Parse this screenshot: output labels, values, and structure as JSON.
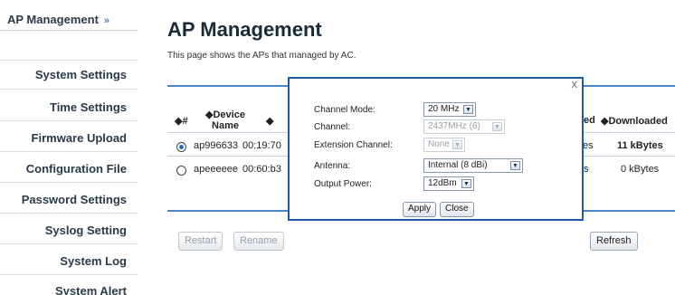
{
  "sidebar": {
    "header": "AP Management",
    "items": [
      {
        "label": "System Settings"
      },
      {
        "label": "Time Settings"
      },
      {
        "label": "Firmware Upload"
      },
      {
        "label": "Configuration File"
      },
      {
        "label": "Password Settings"
      },
      {
        "label": "Syslog Setting"
      },
      {
        "label": "System Log"
      },
      {
        "label": "System Alert"
      }
    ]
  },
  "main": {
    "title": "AP Management",
    "subtitle": "This page shows the APs that managed by AC.",
    "table": {
      "headers": {
        "select": "◆#",
        "device_name": "Device Name",
        "col3": "◆",
        "col_ed": "ed",
        "downloaded": "◆Downloaded"
      },
      "rows": [
        {
          "selected": true,
          "device": "ap996633",
          "mac": "00:19:70",
          "partial": "es",
          "downloaded": "11 kBytes"
        },
        {
          "selected": false,
          "device": "apeeeeee",
          "mac": "00:60:b3",
          "partial": "s",
          "downloaded": "0 kBytes"
        }
      ]
    },
    "buttons": {
      "restart": "Restart",
      "rename": "Rename",
      "refresh": "Refresh"
    }
  },
  "modal": {
    "close_x": "X",
    "fields": [
      {
        "label": "Channel Mode:",
        "value": "20 MHz",
        "disabled": false
      },
      {
        "label": "Channel:",
        "value": "2437MHz (6)",
        "disabled": true
      },
      {
        "label": "Extension Channel:",
        "value": "None",
        "disabled": true
      },
      {
        "label": "Antenna:",
        "value": "Internal (8 dBi)",
        "disabled": false
      },
      {
        "label": "Output Power:",
        "value": "12dBm",
        "disabled": false
      }
    ],
    "apply_label": "Apply",
    "close_label": "Close"
  }
}
